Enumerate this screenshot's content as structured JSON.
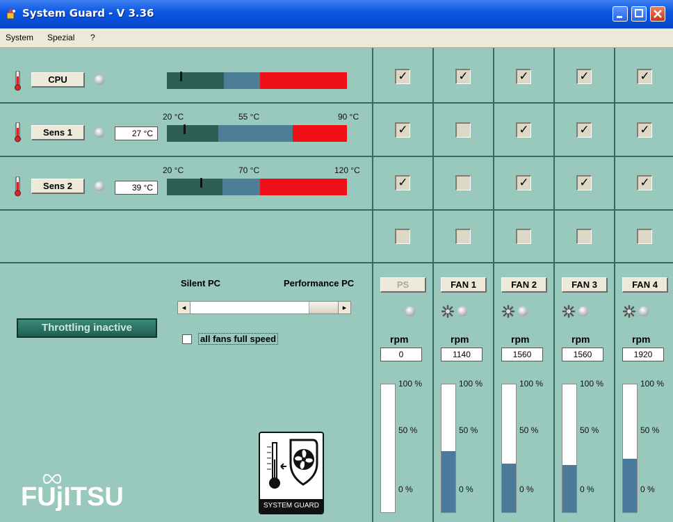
{
  "window": {
    "title": "System Guard - V 3.36"
  },
  "menu": {
    "items": [
      "System",
      "Spezial",
      "?"
    ]
  },
  "sensors": [
    {
      "label": "CPU",
      "temp": "",
      "scale": [
        "",
        "",
        ""
      ],
      "checks": [
        true,
        true,
        true,
        true,
        true
      ]
    },
    {
      "label": "Sens 1",
      "temp": "27 °C",
      "scale": [
        "20 °C",
        "55 °C",
        "90 °C"
      ],
      "checks": [
        true,
        false,
        true,
        true,
        true
      ]
    },
    {
      "label": "Sens 2",
      "temp": "39 °C",
      "scale": [
        "20 °C",
        "70 °C",
        "120 °C"
      ],
      "checks": [
        true,
        false,
        true,
        true,
        true
      ]
    },
    {
      "label": "",
      "temp": "",
      "scale": [
        "",
        "",
        ""
      ],
      "checks": [
        false,
        false,
        false,
        false,
        false
      ]
    }
  ],
  "colors": {
    "bar_low": "#2d5f52",
    "bar_mid": "#4c7e98",
    "bar_high": "#ee0f17",
    "fan_fill": "#4a7a9c",
    "background": "#99c8bc",
    "divider": "#2f6c61"
  },
  "throttling": {
    "label": "Throttling inactive"
  },
  "profile": {
    "left_label": "Silent PC",
    "right_label": "Performance PC",
    "left_arrow": "◂",
    "right_arrow": "▸",
    "full_speed_label": "all fans full speed",
    "full_speed_checked": false
  },
  "fans": [
    {
      "label": "PS",
      "enabled": false,
      "rpm_label": "rpm",
      "rpm": "0",
      "level": 0.0,
      "pct_top": "100 %",
      "pct_mid": "50 %",
      "pct_bottom": "0 %",
      "icon": false
    },
    {
      "label": "FAN 1",
      "enabled": true,
      "rpm_label": "rpm",
      "rpm": "1140",
      "level": 0.48,
      "pct_top": "100 %",
      "pct_mid": "50 %",
      "pct_bottom": "0 %",
      "icon": true
    },
    {
      "label": "FAN 2",
      "enabled": true,
      "rpm_label": "rpm",
      "rpm": "1560",
      "level": 0.38,
      "pct_top": "100 %",
      "pct_mid": "50 %",
      "pct_bottom": "0 %",
      "icon": true
    },
    {
      "label": "FAN 3",
      "enabled": true,
      "rpm_label": "rpm",
      "rpm": "1560",
      "level": 0.37,
      "pct_top": "100 %",
      "pct_mid": "50 %",
      "pct_bottom": "0 %",
      "icon": true
    },
    {
      "label": "FAN 4",
      "enabled": true,
      "rpm_label": "rpm",
      "rpm": "1920",
      "level": 0.42,
      "pct_top": "100 %",
      "pct_mid": "50 %",
      "pct_bottom": "0 %",
      "icon": true
    }
  ],
  "branding": {
    "logo_caption": "SYSTEM GUARD",
    "vendor": "FUjITSU"
  }
}
